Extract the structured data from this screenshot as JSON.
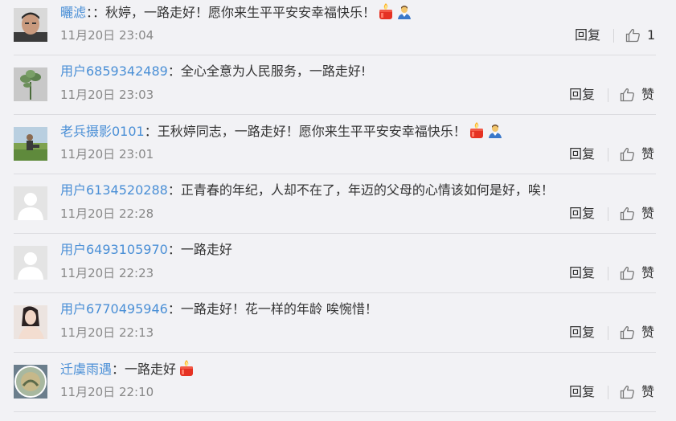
{
  "comments": [
    {
      "user": "曬滤",
      "sep": "：",
      "text": "：秋婷，一路走好！愿你来生平平安安幸福快乐！",
      "emojis": [
        "candle",
        "person"
      ],
      "time": "11月20日 23:04",
      "reply": "回复",
      "like": "1",
      "avatar": "photo-man"
    },
    {
      "user": "用户6859342489",
      "sep": "：",
      "text": "全心全意为人民服务，一路走好!",
      "emojis": [],
      "time": "11月20日 23:03",
      "reply": "回复",
      "like": "赞",
      "avatar": "photo-plant"
    },
    {
      "user": "老兵摄影0101",
      "sep": "：",
      "text": "王秋婷同志，一路走好！愿你来生平平安安幸福快乐！",
      "emojis": [
        "candle",
        "person"
      ],
      "time": "11月20日 23:01",
      "reply": "回复",
      "like": "赞",
      "avatar": "photo-outdoor"
    },
    {
      "user": "用户6134520288",
      "sep": "：",
      "text": "正青春的年纪，人却不在了，年迈的父母的心情该如何是好，唉！",
      "emojis": [],
      "time": "11月20日 22:28",
      "reply": "回复",
      "like": "赞",
      "avatar": "default-user"
    },
    {
      "user": "用户6493105970",
      "sep": "：",
      "text": "一路走好",
      "emojis": [],
      "time": "11月20日 22:23",
      "reply": "回复",
      "like": "赞",
      "avatar": "default-user"
    },
    {
      "user": "用户6770495946",
      "sep": "：",
      "text": "一路走好！花一样的年龄 唉惋惜！",
      "emojis": [],
      "time": "11月20日 22:13",
      "reply": "回复",
      "like": "赞",
      "avatar": "photo-woman"
    },
    {
      "user": "迁虞雨遇",
      "sep": "：",
      "text": "一路走好",
      "emojis": [
        "candle"
      ],
      "time": "11月20日 22:10",
      "reply": "回复",
      "like": "赞",
      "avatar": "photo-circle"
    }
  ],
  "colors": {
    "background": "#f2f2f5",
    "username": "#4a8fd6",
    "text": "#333333",
    "time": "#888888",
    "divider": "#dcdce0"
  }
}
